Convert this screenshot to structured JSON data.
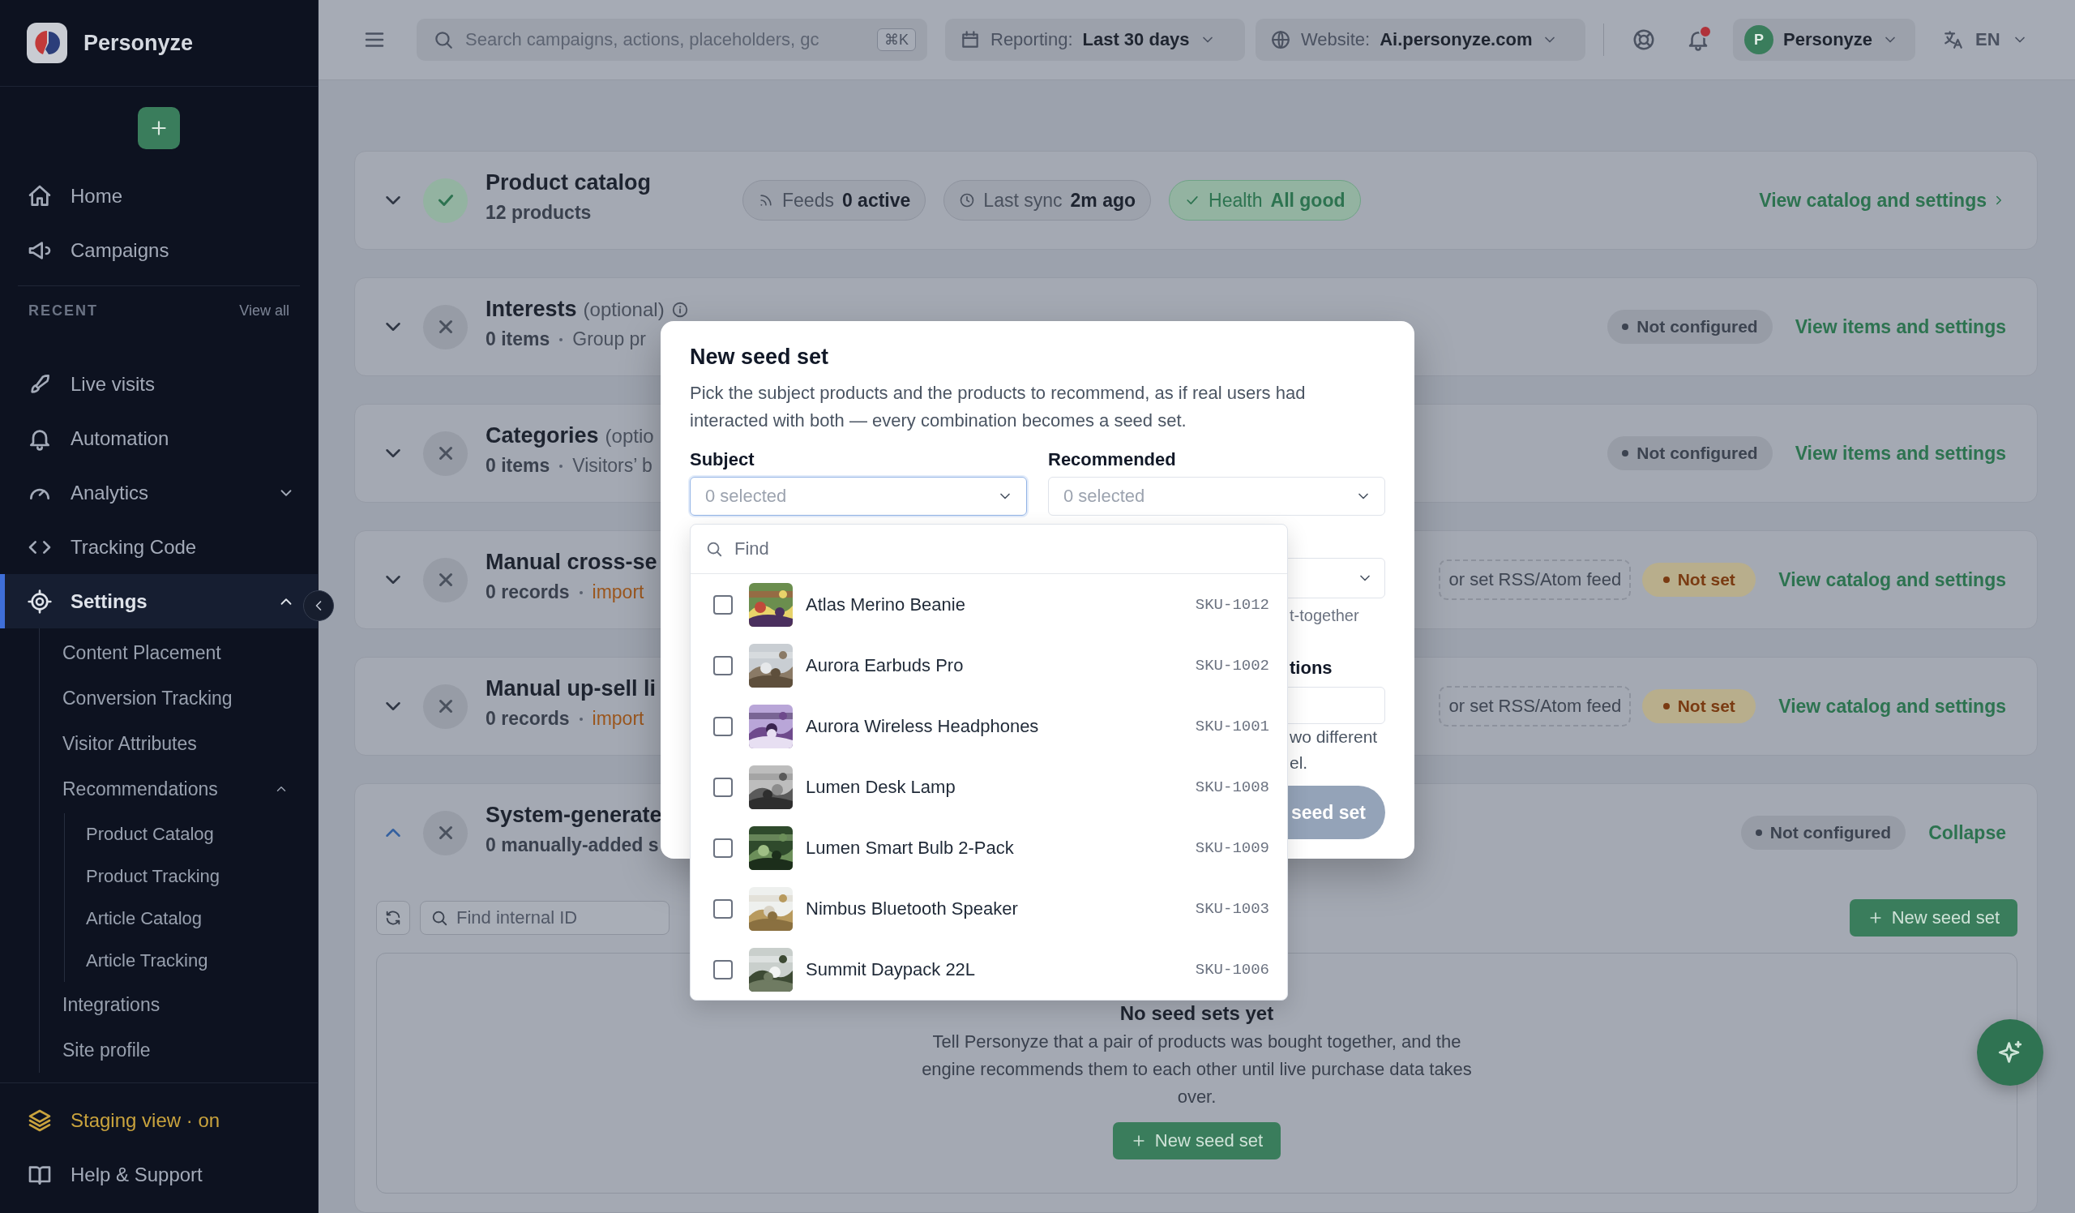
{
  "sidebar": {
    "brand": "Personyze",
    "nav": [
      {
        "label": "Home",
        "selected": false
      },
      {
        "label": "Campaigns",
        "selected": false
      }
    ],
    "recent": {
      "heading": "RECENT",
      "link": "View all"
    },
    "nav2": [
      {
        "label": "Live visits",
        "selected": false,
        "kind": "link"
      },
      {
        "label": "Automation",
        "selected": false,
        "kind": "link"
      },
      {
        "label": "Analytics",
        "selected": false,
        "kind": "group",
        "expanded": false
      },
      {
        "label": "Tracking Code",
        "selected": false,
        "kind": "link"
      },
      {
        "label": "Settings",
        "selected": true,
        "kind": "group",
        "expanded": true,
        "children": [
          {
            "label": "Content Placement",
            "selected": false
          },
          {
            "label": "Conversion Tracking",
            "selected": false
          },
          {
            "label": "Visitor Attributes",
            "selected": false
          },
          {
            "label": "Recommendations",
            "selected": false,
            "expanded": true,
            "children": [
              {
                "label": "Product Catalog",
                "selected": false
              },
              {
                "label": "Product Tracking",
                "selected": false
              },
              {
                "label": "Article Catalog",
                "selected": false
              },
              {
                "label": "Article Tracking",
                "selected": false
              }
            ]
          },
          {
            "label": "Integrations",
            "selected": false
          },
          {
            "label": "Site profile",
            "selected": false
          }
        ]
      }
    ],
    "footer": [
      {
        "label": "Staging view · on",
        "kind": "staging"
      },
      {
        "label": "Help & Support",
        "kind": "help"
      }
    ]
  },
  "topbar": {
    "search": {
      "placeholder": "Search campaigns, actions, placeholders, gc",
      "shortcut": "⌘K"
    },
    "reporting": {
      "label": "Reporting:",
      "value": "Last 30 days"
    },
    "website": {
      "label": "Website:",
      "value": "Ai.personyze.com"
    },
    "notifications": {
      "unread": true
    },
    "user": {
      "initial": "P",
      "name": "Personyze"
    },
    "language": "EN"
  },
  "cards": [
    {
      "title": "Product catalog",
      "configured": true,
      "expanded": false,
      "count": "12 products",
      "pills": [
        {
          "kind": "feeds",
          "label": "Feeds",
          "value": "0 active"
        },
        {
          "kind": "sync",
          "label": "Last sync",
          "value": "2m ago"
        },
        {
          "kind": "health",
          "label": "Health",
          "value": "All good"
        }
      ],
      "link": "View catalog and settings",
      "link_chevron": true
    },
    {
      "title": "Interests",
      "note": "(optional)",
      "info": true,
      "configured": false,
      "expanded": false,
      "count": "0 items",
      "detail": "Group pr",
      "detail_link": false,
      "badge": {
        "label": "Not configured",
        "warning": false
      },
      "link": "View items and settings"
    },
    {
      "title": "Categories",
      "note": "(optio",
      "configured": false,
      "expanded": false,
      "count": "0 items",
      "detail": "Visitors’ b",
      "detail_link": false,
      "badge": {
        "label": "Not configured",
        "warning": false
      },
      "link": "View items and settings"
    },
    {
      "title": "Manual cross-se",
      "configured": false,
      "expanded": false,
      "count": "0 records",
      "detail": "import",
      "detail_link": true,
      "feed": "or set RSS/Atom feed",
      "badge": {
        "label": "Not set",
        "warning": true
      },
      "link": "View catalog and settings"
    },
    {
      "title": "Manual up-sell li",
      "configured": false,
      "expanded": false,
      "count": "0 records",
      "detail": "import",
      "detail_link": true,
      "feed": "or set RSS/Atom feed",
      "badge": {
        "label": "Not set",
        "warning": true
      },
      "link": "View catalog and settings"
    },
    {
      "title": "System-generate",
      "configured": false,
      "expanded": true,
      "count": "0 manually-added s",
      "badge": {
        "label": "Not configured",
        "warning": false
      },
      "link": "Collapse",
      "body": {
        "search_placeholder": "Find internal ID",
        "new_button": "New seed set",
        "empty": {
          "title": "No seed sets yet",
          "text": "Tell Personyze that a pair of products was bought together, and the engine recommends them to each other until live purchase data takes over.",
          "button": "New seed set"
        }
      }
    }
  ],
  "modal": {
    "title": "New seed set",
    "description": "Pick the subject products and the products to recommend, as if real users had interacted with both — every combination becomes a seed set.",
    "fields": [
      {
        "label": "Subject",
        "placeholder": "0 selected",
        "open": true
      },
      {
        "label": "Recommended",
        "placeholder": "0 selected",
        "open": false
      }
    ],
    "picker": {
      "search_placeholder": "Find",
      "items": [
        {
          "name": "Atlas Merino Beanie",
          "sku": "SKU-1012",
          "checked": false
        },
        {
          "name": "Aurora Earbuds Pro",
          "sku": "SKU-1002",
          "checked": false
        },
        {
          "name": "Aurora Wireless Headphones",
          "sku": "SKU-1001",
          "checked": false
        },
        {
          "name": "Lumen Desk Lamp",
          "sku": "SKU-1008",
          "checked": false
        },
        {
          "name": "Lumen Smart Bulb 2-Pack",
          "sku": "SKU-1009",
          "checked": false
        },
        {
          "name": "Nimbus Bluetooth Speaker",
          "sku": "SKU-1003",
          "checked": false
        },
        {
          "name": "Summit Daypack 22L",
          "sku": "SKU-1006",
          "checked": false
        }
      ]
    },
    "covered": {
      "hint": "t-together",
      "label": "tions",
      "help": [
        "wo different",
        "el."
      ],
      "button": {
        "label": "seed set",
        "disabled": true
      }
    }
  }
}
